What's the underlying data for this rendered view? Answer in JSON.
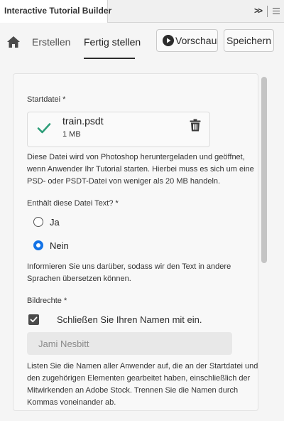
{
  "window": {
    "title": "Interactive Tutorial Builder"
  },
  "nav": {
    "tabs": [
      {
        "label": "Erstellen"
      },
      {
        "label": "Fertig stellen",
        "active": true
      }
    ],
    "preview_label": "Vorschau",
    "save_label": "Speichern"
  },
  "form": {
    "start_file": {
      "label": "Startdatei *",
      "file_name": "train.psdt",
      "file_size": "1 MB",
      "help": "Diese Datei wird von Photoshop heruntergeladen und geöffnet, wenn Anwender Ihr Tutorial starten. Hierbei muss es sich um eine PSD- oder PSDT-Datei von weniger als 20 MB handeln."
    },
    "contains_text": {
      "label": "Enthält diese Datei Text? *",
      "options": [
        {
          "label": "Ja",
          "selected": false
        },
        {
          "label": "Nein",
          "selected": true
        }
      ],
      "help": "Informieren Sie uns darüber, sodass wir den Text in andere Sprachen übersetzen können."
    },
    "image_rights": {
      "label": "Bildrechte *",
      "include_name_label": "Schließen Sie Ihren Namen mit ein.",
      "include_name_checked": true,
      "name_placeholder": "Jami Nesbitt",
      "help": "Listen Sie die Namen aller Anwender auf, die an der Startdatei und den zugehörigen Elementen gearbeitet haben, einschließlich der Mitwirkenden an Adobe Stock. Trennen Sie die Namen durch Kommas voneinander ab."
    }
  },
  "colors": {
    "accent": "#1473e6",
    "check": "#2d9d78"
  },
  "icons": [
    "home-icon",
    "play-icon",
    "check-icon",
    "trash-icon",
    "menu-icon",
    "double-chevron-icon"
  ]
}
